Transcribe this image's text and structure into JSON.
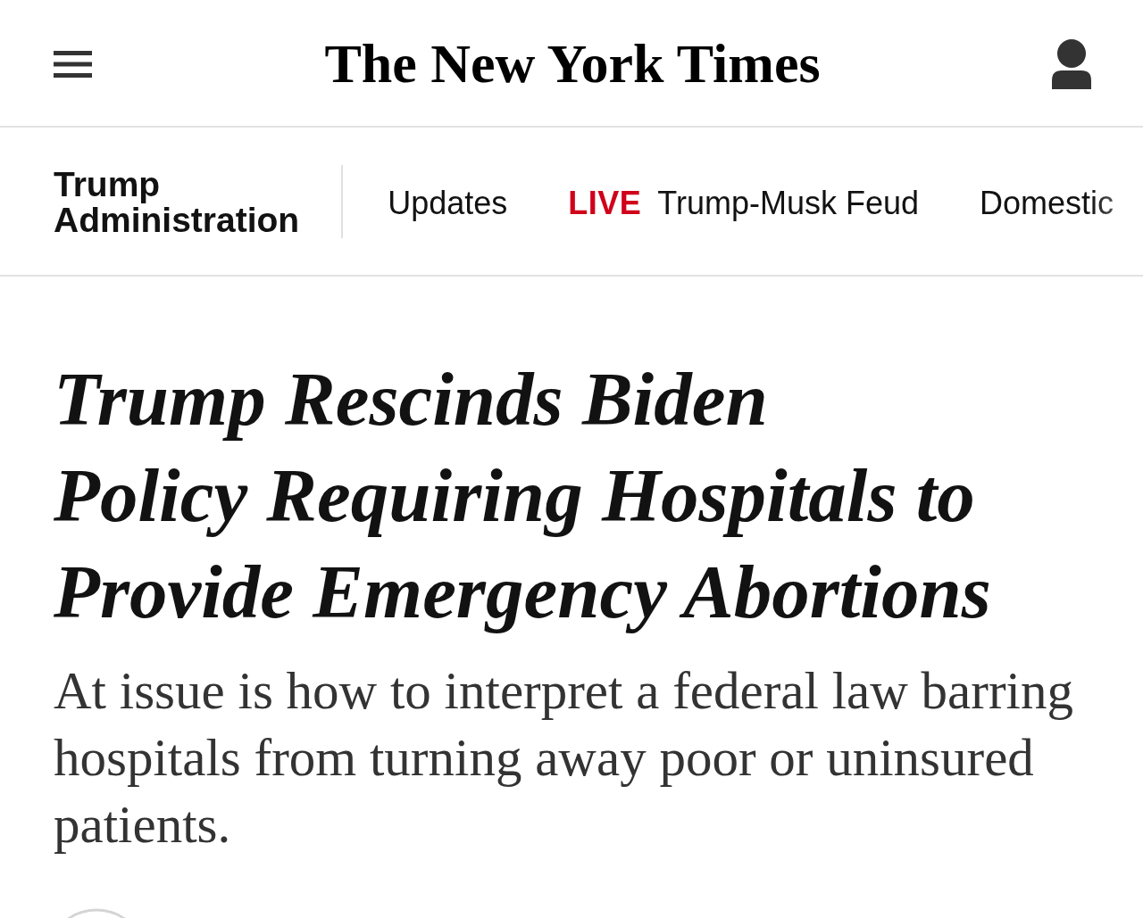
{
  "masthead": {
    "logo": "The New York Times"
  },
  "section_nav": {
    "section": "Trump Administration",
    "links": [
      {
        "label": "Updates"
      },
      {
        "badge": "LIVE",
        "label": "Trump-Musk Feud"
      },
      {
        "label": "Domestic"
      }
    ]
  },
  "article": {
    "headline": [
      "Trump Rescinds Biden",
      "Policy Requiring Hospitals to",
      "Provide Emergency Abortions"
    ],
    "summary": "At issue is how to interpret a federal law barring hospitals from turning away poor or uninsured patients."
  }
}
